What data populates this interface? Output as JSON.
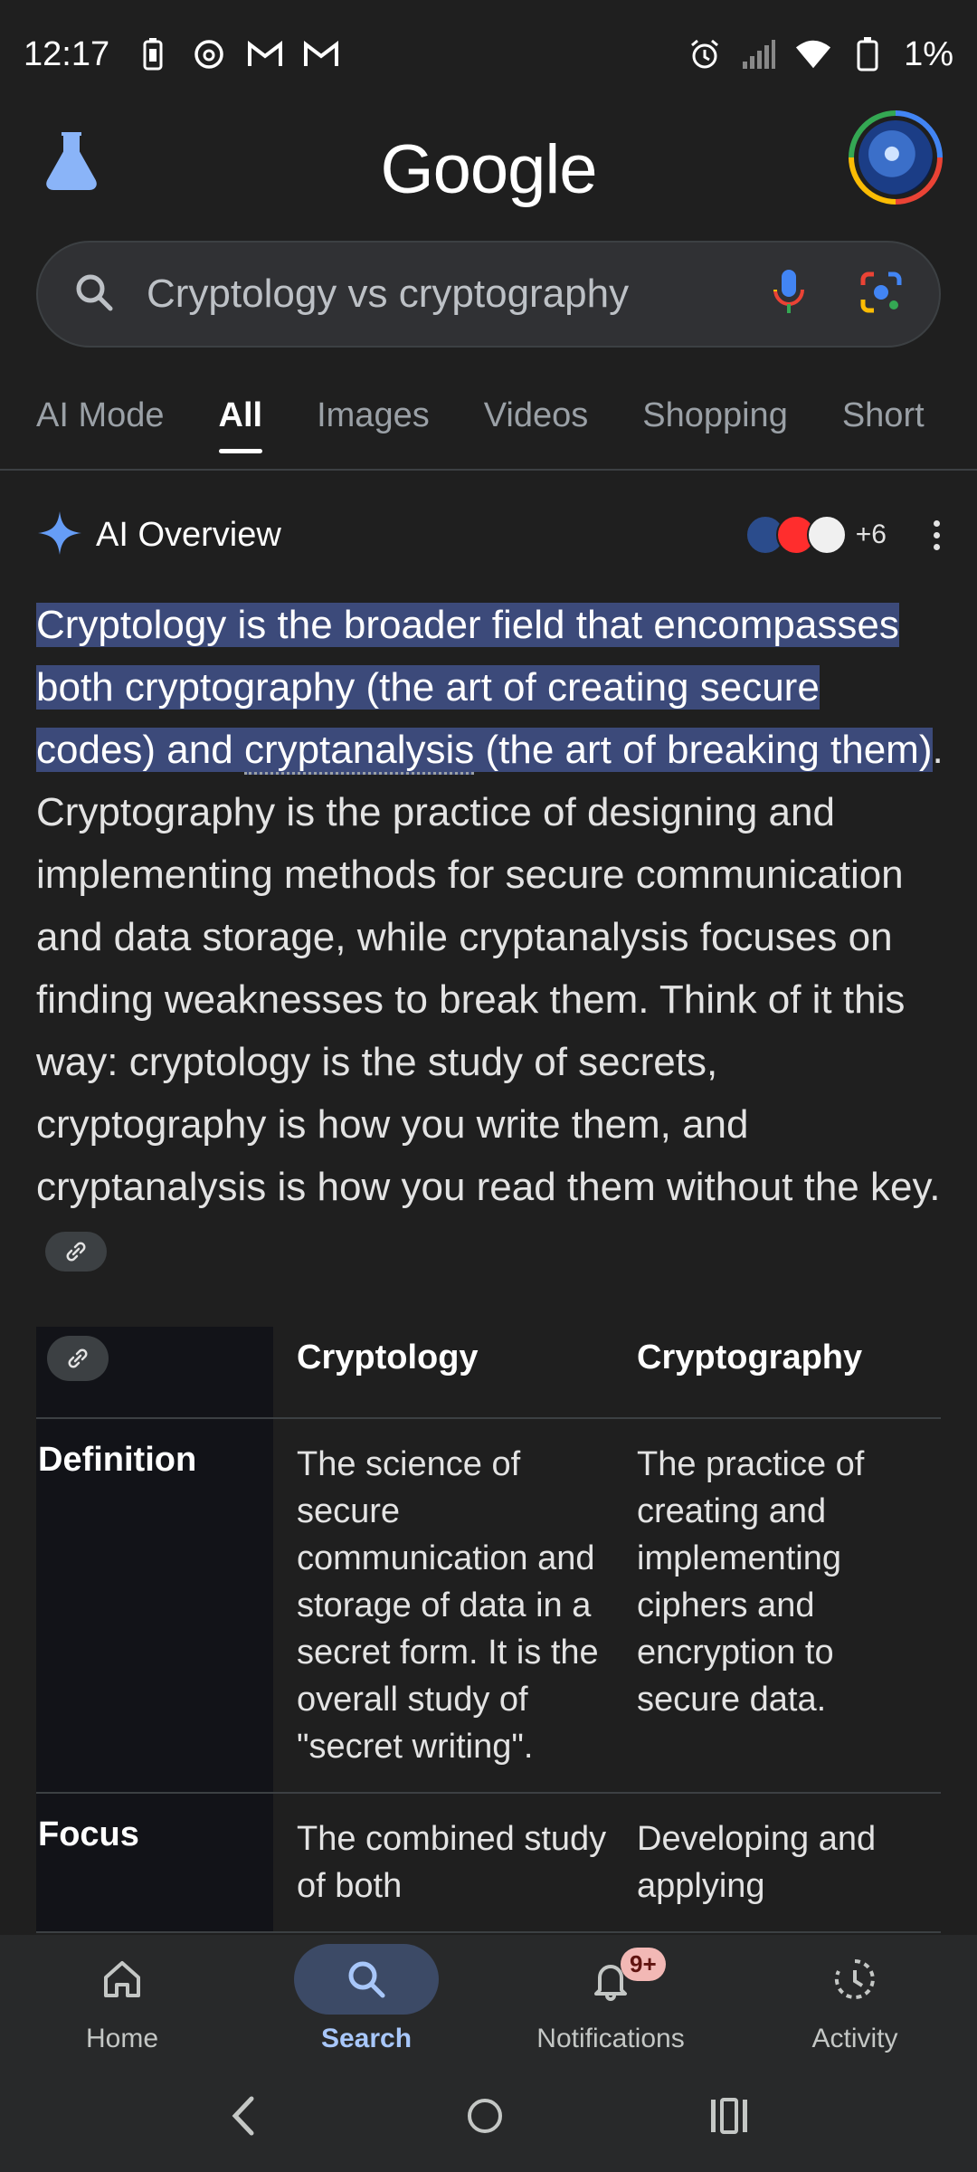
{
  "status": {
    "time": "12:17",
    "battery": "1%",
    "left_icons": [
      "battery-saver-icon",
      "threads-icon",
      "gmail-icon",
      "gmail-icon"
    ],
    "right_icons": [
      "alarm-icon",
      "signal-icon",
      "wifi-icon",
      "battery-icon"
    ]
  },
  "header": {
    "logo": "Google",
    "left_icon": "labs-flask-icon",
    "avatar": "profile-avatar"
  },
  "search": {
    "query": "Cryptology vs cryptography",
    "icons": [
      "search-icon",
      "microphone-icon",
      "lens-icon"
    ]
  },
  "tabs": [
    "AI Mode",
    "All",
    "Images",
    "Videos",
    "Shopping",
    "Short"
  ],
  "active_tab": "All",
  "ai_overview": {
    "title": "AI Overview",
    "more_sources": "+6",
    "hl_1": "Cryptology is the broader field that encompasses both cryptography (the art of creating secure codes) and ",
    "hl_2": "cryptanalysis",
    "hl_3": " (the art of breaking them)",
    "body": ". Cryptography is the practice of designing and implementing methods for secure communication and data storage, while cryptanalysis focuses on finding weaknesses to break them. Think of it this way: cryptology is the study of secrets, cryptography is how you write them, and cryptanalysis is how you read them without the key."
  },
  "table": {
    "col1": "Cryptology",
    "col2": "Cryptography",
    "rows": [
      {
        "label": "Definition",
        "c1": "The science of secure communication and storage of data in a secret form. It is the overall study of \"secret writing\".",
        "c2": "The practice of creating and implementing ciphers and encryption to secure data."
      },
      {
        "label": "Focus",
        "c1": "The combined study of both",
        "c2": "Developing and applying"
      }
    ]
  },
  "bottom_nav": {
    "items": [
      {
        "label": "Home",
        "icon": "home-icon"
      },
      {
        "label": "Search",
        "icon": "search-icon"
      },
      {
        "label": "Notifications",
        "icon": "bell-icon",
        "badge": "9+"
      },
      {
        "label": "Activity",
        "icon": "activity-icon"
      }
    ],
    "active": "Search"
  },
  "colors": {
    "background": "#1f1f1f",
    "highlight": "#3c4a7a",
    "accent": "#a8c7fa",
    "badge": "#f2b8b5"
  }
}
